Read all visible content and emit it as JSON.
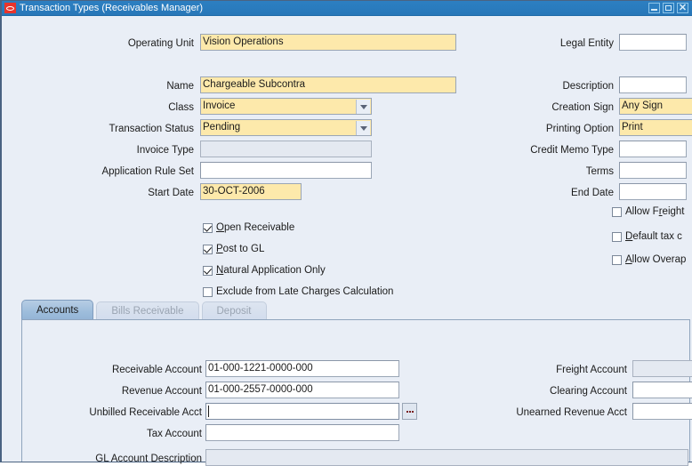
{
  "window": {
    "title": "Transaction Types (Receivables Manager)",
    "logo_icon": "oracle-logo-icon",
    "minimize_icon": "minimize-icon",
    "maximize_icon": "maximize-icon",
    "close_icon": "close-icon",
    "close_glyph": "✕",
    "titlebar_color": "#2d7fc1",
    "canvas_color": "#e9eef6",
    "required_field_color": "#fde9ab",
    "disabled_field_color": "#e4e9f1"
  },
  "header": {
    "left_fields": [
      {
        "label": "Operating Unit",
        "value": "Vision Operations",
        "state": "required"
      },
      {
        "label": "Name",
        "value": "Chargeable Subcontra",
        "state": "required"
      },
      {
        "label": "Class",
        "value": "Invoice",
        "state": "required",
        "control": "poplist"
      },
      {
        "label": "Transaction Status",
        "value": "Pending",
        "state": "required",
        "control": "poplist"
      },
      {
        "label": "Invoice Type",
        "value": "",
        "state": "disabled"
      },
      {
        "label": "Application Rule Set",
        "value": "",
        "state": "enabled"
      },
      {
        "label": "Start Date",
        "value": "30-OCT-2006",
        "state": "required"
      }
    ],
    "right_fields": [
      {
        "label": "Legal Entity",
        "value": "",
        "state": "enabled"
      },
      {
        "label": "Description",
        "value": "",
        "state": "enabled"
      },
      {
        "label": "Creation Sign",
        "value": "Any Sign",
        "state": "required"
      },
      {
        "label": "Printing Option",
        "value": "Print",
        "state": "required"
      },
      {
        "label": "Credit Memo Type",
        "value": "",
        "state": "enabled"
      },
      {
        "label": "Terms",
        "value": "",
        "state": "enabled"
      },
      {
        "label": "End Date",
        "value": "",
        "state": "enabled"
      }
    ],
    "left_checkboxes": [
      {
        "label": "Open Receivable",
        "mnemonic": "O",
        "checked": true
      },
      {
        "label": "Post to GL",
        "mnemonic": "P",
        "checked": true
      },
      {
        "label": "Natural Application Only",
        "mnemonic": "N",
        "checked": true
      },
      {
        "label": "Exclude from Late Charges Calculation",
        "mnemonic": "",
        "checked": false
      }
    ],
    "right_checkboxes": [
      {
        "label": "Allow Freight",
        "mnemonic": "r",
        "checked": false
      },
      {
        "label": "Default tax c",
        "mnemonic": "D",
        "checked": false
      },
      {
        "label": "Allow Overap",
        "mnemonic": "A",
        "checked": false
      }
    ]
  },
  "tabs": [
    {
      "label": "Accounts",
      "active": true
    },
    {
      "label": "Bills Receivable",
      "active": false
    },
    {
      "label": "Deposit",
      "active": false
    }
  ],
  "accounts_tab": {
    "left_fields": [
      {
        "label": "Receivable Account",
        "value": "01-000-1221-0000-000",
        "state": "enabled"
      },
      {
        "label": "Revenue Account",
        "value": "01-000-2557-0000-000",
        "state": "enabled"
      },
      {
        "label": "Unbilled Receivable Acct",
        "value": "",
        "state": "focused",
        "lov": true
      },
      {
        "label": "Tax Account",
        "value": "",
        "state": "enabled"
      },
      {
        "label": "GL Account Description",
        "value": "",
        "state": "disabled"
      }
    ],
    "right_fields": [
      {
        "label": "Freight Account",
        "value": "",
        "state": "disabled"
      },
      {
        "label": "Clearing Account",
        "value": "",
        "state": "enabled"
      },
      {
        "label": "Unearned Revenue Acct",
        "value": "",
        "state": "enabled"
      }
    ],
    "lov_icon": "ellipsis-lov-icon"
  }
}
